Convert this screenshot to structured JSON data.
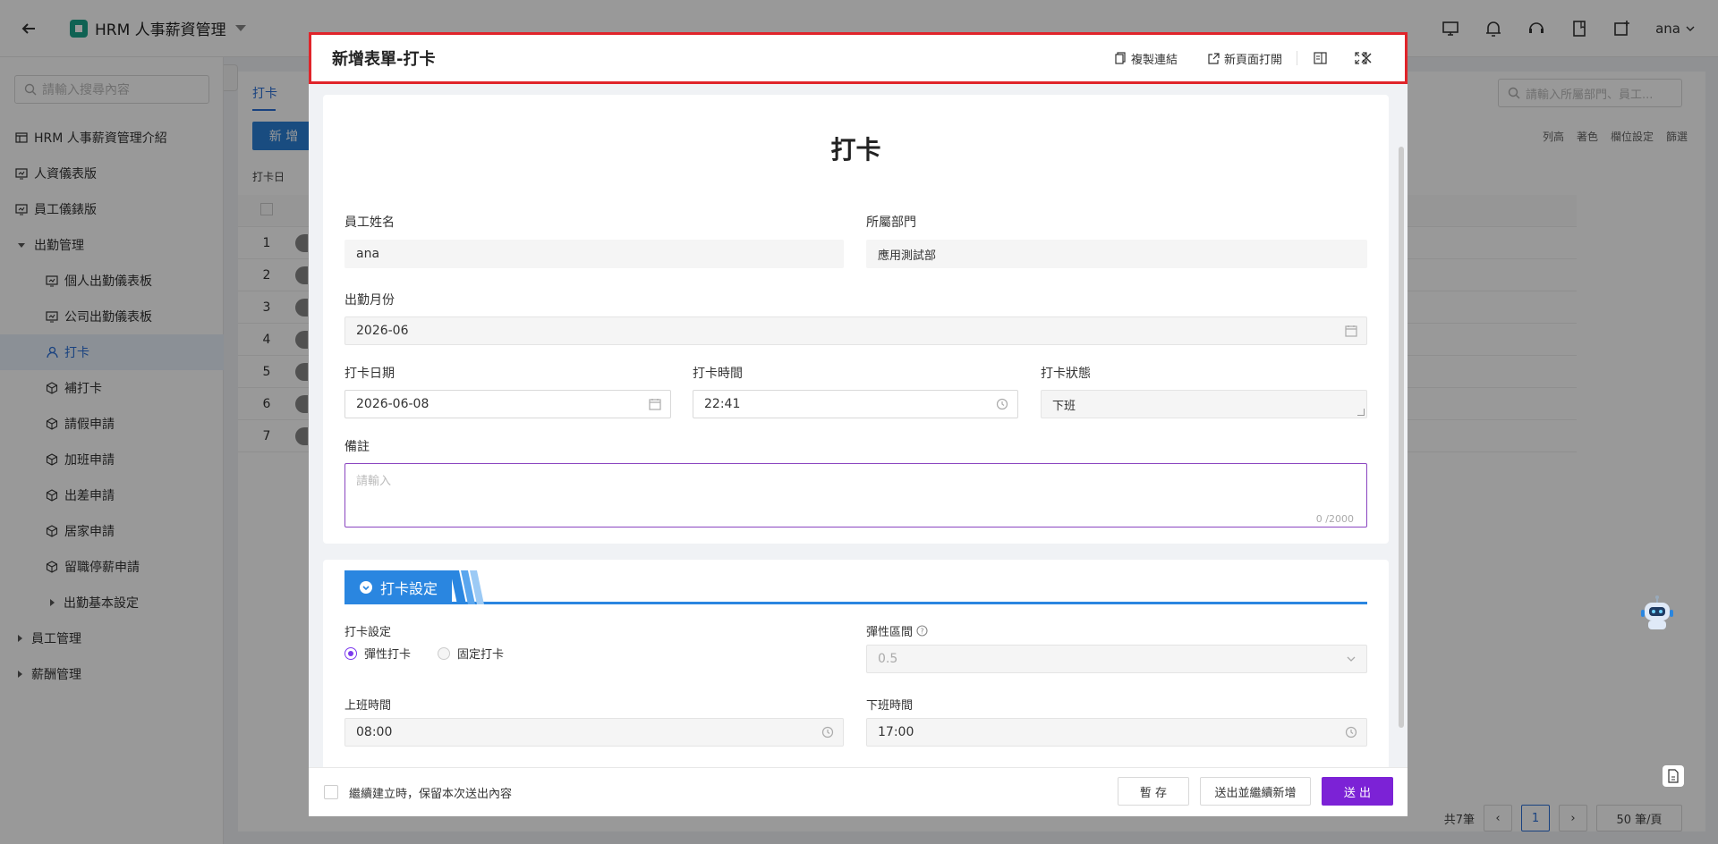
{
  "app": {
    "title": "HRM 人事薪資管理",
    "user": "ana"
  },
  "sidebar": {
    "search_placeholder": "請輸入搜尋內容",
    "items": [
      {
        "label": "HRM 人事薪資管理介紹"
      },
      {
        "label": "人資儀表版"
      },
      {
        "label": "員工儀錶版"
      },
      {
        "label": "出勤管理"
      },
      {
        "label": "個人出勤儀表板"
      },
      {
        "label": "公司出勤儀表板"
      },
      {
        "label": "打卡"
      },
      {
        "label": "補打卡"
      },
      {
        "label": "請假申請"
      },
      {
        "label": "加班申請"
      },
      {
        "label": "出差申請"
      },
      {
        "label": "居家申請"
      },
      {
        "label": "留職停薪申請"
      },
      {
        "label": "出勤基本設定"
      },
      {
        "label": "員工管理"
      },
      {
        "label": "薪酬管理"
      }
    ]
  },
  "background": {
    "tab": "打卡",
    "add_button": "新 增",
    "search_placeholder": "請輸入所屬部門、員工...",
    "tools": [
      "列高",
      "著色",
      "欄位設定",
      "篩選"
    ],
    "filter_chip": "打卡日",
    "rows": [
      "1",
      "2",
      "3",
      "4",
      "5",
      "6",
      "7"
    ],
    "pager_total": "共7筆",
    "pager_current": "1",
    "pager_size": "50 筆/頁"
  },
  "modal": {
    "title": "新增表單-打卡",
    "copy_link": "複製連結",
    "open_new_page": "新頁面打開",
    "form_title": "打卡",
    "fields": {
      "employee_name": {
        "label": "員工姓名",
        "value": "ana"
      },
      "department": {
        "label": "所屬部門",
        "value": "應用測試部"
      },
      "attendance_month": {
        "label": "出勤月份",
        "value": "2026-06"
      },
      "punch_date": {
        "label": "打卡日期",
        "value": "2026-06-08"
      },
      "punch_time": {
        "label": "打卡時間",
        "value": "22:41"
      },
      "punch_status": {
        "label": "打卡狀態",
        "value": "下班"
      },
      "remarks": {
        "label": "備註",
        "placeholder": "請輸入",
        "counter": "0 /2000"
      }
    },
    "section": {
      "title": "打卡設定",
      "setting_label": "打卡設定",
      "options": [
        "彈性打卡",
        "固定打卡"
      ],
      "flex_range": {
        "label": "彈性區間",
        "value": "0.5"
      },
      "start_time": {
        "label": "上班時間",
        "value": "08:00"
      },
      "end_time": {
        "label": "下班時間",
        "value": "17:00"
      }
    },
    "footer": {
      "keep_label": "繼續建立時，保留本次送出內容",
      "save": "暫 存",
      "submit_continue": "送出並繼續新增",
      "submit": "送 出"
    }
  }
}
